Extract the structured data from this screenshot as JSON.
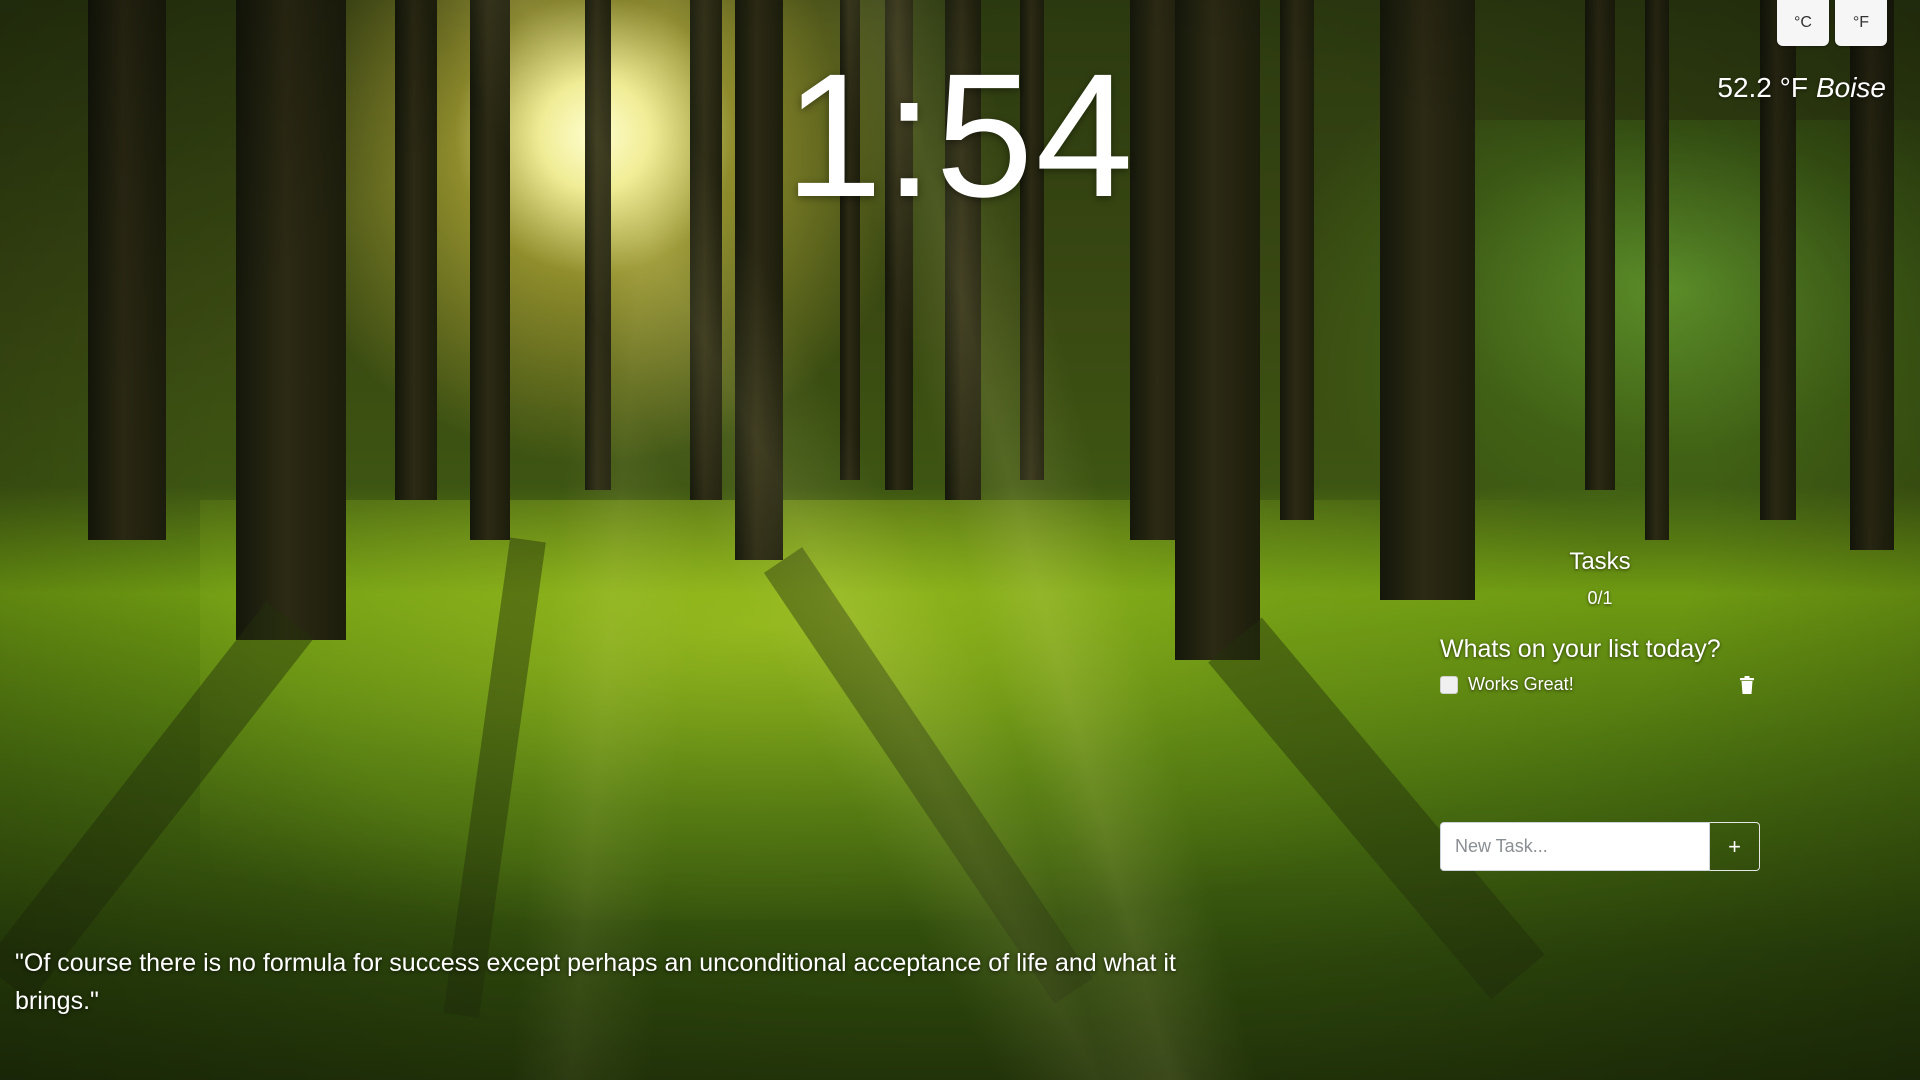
{
  "units": {
    "celsius_label": "°C",
    "fahrenheit_label": "°F"
  },
  "weather": {
    "temperature": "52.2 °F",
    "city": "Boise"
  },
  "clock": {
    "time": "1:54"
  },
  "tasks": {
    "title": "Tasks",
    "count": "0/1",
    "question": "Whats on your list today?",
    "items": [
      {
        "label": "Works Great!",
        "checked": false
      }
    ],
    "new_task_placeholder": "New Task...",
    "add_label": "+"
  },
  "quote": {
    "text": "\"Of course there is no formula for success except perhaps an unconditional acceptance of life and what it brings.\""
  },
  "icons": {
    "delete": "trash-icon"
  },
  "colors": {
    "text": "#ffffff",
    "button_bg": "#f6f6f6"
  }
}
